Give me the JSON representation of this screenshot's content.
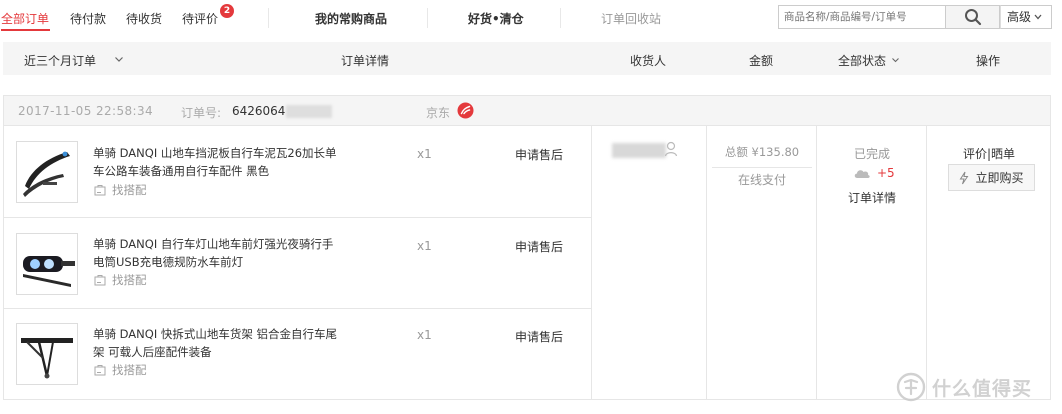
{
  "tabs": {
    "all_orders": "全部订单",
    "pending_payment": "待付款",
    "pending_receipt": "待收货",
    "pending_review": "待评价",
    "pending_review_count": "2",
    "frequent_items": "我的常购商品",
    "clearance": "好货•清仓",
    "recycle": "订单回收站"
  },
  "search": {
    "placeholder": "商品名称/商品编号/订单号",
    "advanced_label": "高级"
  },
  "columns": {
    "period": "近三个月订单",
    "details": "订单详情",
    "recipient": "收货人",
    "amount": "金额",
    "status": "全部状态",
    "actions": "操作"
  },
  "order": {
    "datetime": "2017-11-05 22:58:34",
    "order_no_label": "订单号:",
    "order_no": "6426064",
    "shop": "京东",
    "total": "总额 ¥135.80",
    "payment": "在线支付",
    "status": "已完成",
    "points": "+5",
    "detail_link": "订单详情",
    "review_link": "评价|晒单",
    "buy_again": "立即购买",
    "items": [
      {
        "name": "单骑 DANQI 山地车挡泥板自行车泥瓦26加长单车公路车装备通用自行车配件 黑色",
        "match": "找搭配",
        "qty": "x1",
        "after_sale": "申请售后",
        "image": "mudguard"
      },
      {
        "name": "单骑 DANQI 自行车灯山地车前灯强光夜骑行手电筒USB充电德规防水车前灯",
        "match": "找搭配",
        "qty": "x1",
        "after_sale": "申请售后",
        "image": "headlight"
      },
      {
        "name": "单骑 DANQI 快拆式山地车货架 铝合金自行车尾架 可载人后座配件装备",
        "match": "找搭配",
        "qty": "x1",
        "after_sale": "申请售后",
        "image": "rear-rack"
      }
    ]
  },
  "watermark": {
    "text": "什么值得买"
  },
  "colors": {
    "accent": "#e4393c",
    "border": "#e6e6e6",
    "header_bg": "#f5f5f5",
    "muted": "#999999"
  }
}
